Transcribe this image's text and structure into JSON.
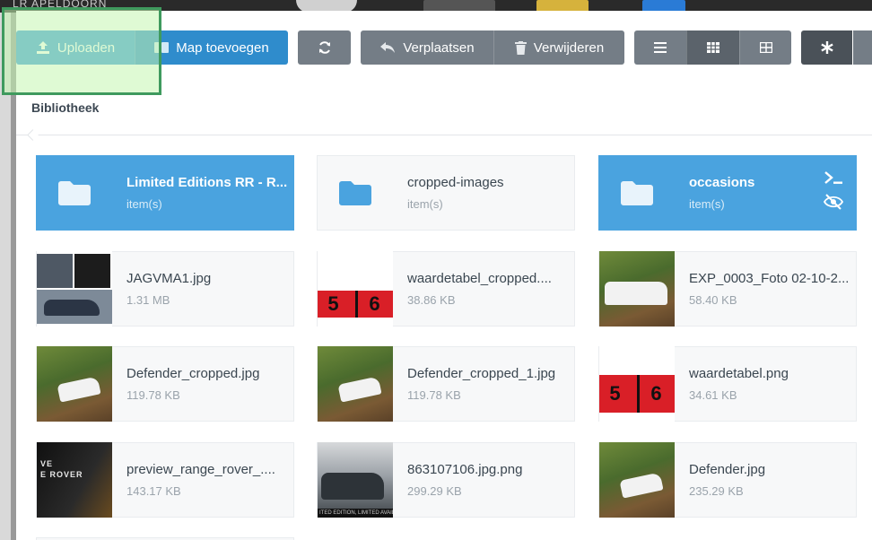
{
  "background": {
    "title": "LR APELDOORN"
  },
  "toolbar": {
    "upload_label": "Uploaden",
    "add_folder_label": "Map toevoegen",
    "move_label": "Verplaatsen",
    "delete_label": "Verwijderen"
  },
  "breadcrumb": {
    "label": "Bibliotheek"
  },
  "folders": [
    {
      "name": "Limited Editions RR - R...",
      "sub": "item(s)",
      "style": "blue"
    },
    {
      "name": "cropped-images",
      "sub": "item(s)",
      "style": "light"
    },
    {
      "name": "occasions",
      "sub": "item(s)",
      "style": "blue"
    }
  ],
  "files": [
    {
      "name": "JAGVMA1.jpg",
      "size": "1.31 MB",
      "thumb": "grid4"
    },
    {
      "name": "waardetabel_cropped....",
      "size": "38.86 KB",
      "thumb": "table"
    },
    {
      "name": "EXP_0003_Foto 02-10-2...",
      "size": "58.40 KB",
      "thumb": "green"
    },
    {
      "name": "Defender_cropped.jpg",
      "size": "119.78 KB",
      "thumb": "green"
    },
    {
      "name": "Defender_cropped_1.jpg",
      "size": "119.78 KB",
      "thumb": "green"
    },
    {
      "name": "waardetabel.png",
      "size": "34.61 KB",
      "thumb": "table"
    },
    {
      "name": "preview_range_rover_....",
      "size": "143.17 KB",
      "thumb": "dark"
    },
    {
      "name": "863107106.jpg.png",
      "size": "299.29 KB",
      "thumb": "show"
    },
    {
      "name": "Defender.jpg",
      "size": "235.29 KB",
      "thumb": "green"
    }
  ],
  "thumb_text": {
    "digit_a": "5",
    "digit_b": "6",
    "preview_line1": "VE",
    "preview_line2": "E ROVER",
    "show_strip": "ITED EDITION, LIMITED AVAILAB"
  },
  "colors": {
    "primary": "#3a9ad9",
    "folder_blue": "#4aa3df",
    "toolbar_gray": "#747d86",
    "highlight_border": "#3f9a5e"
  }
}
